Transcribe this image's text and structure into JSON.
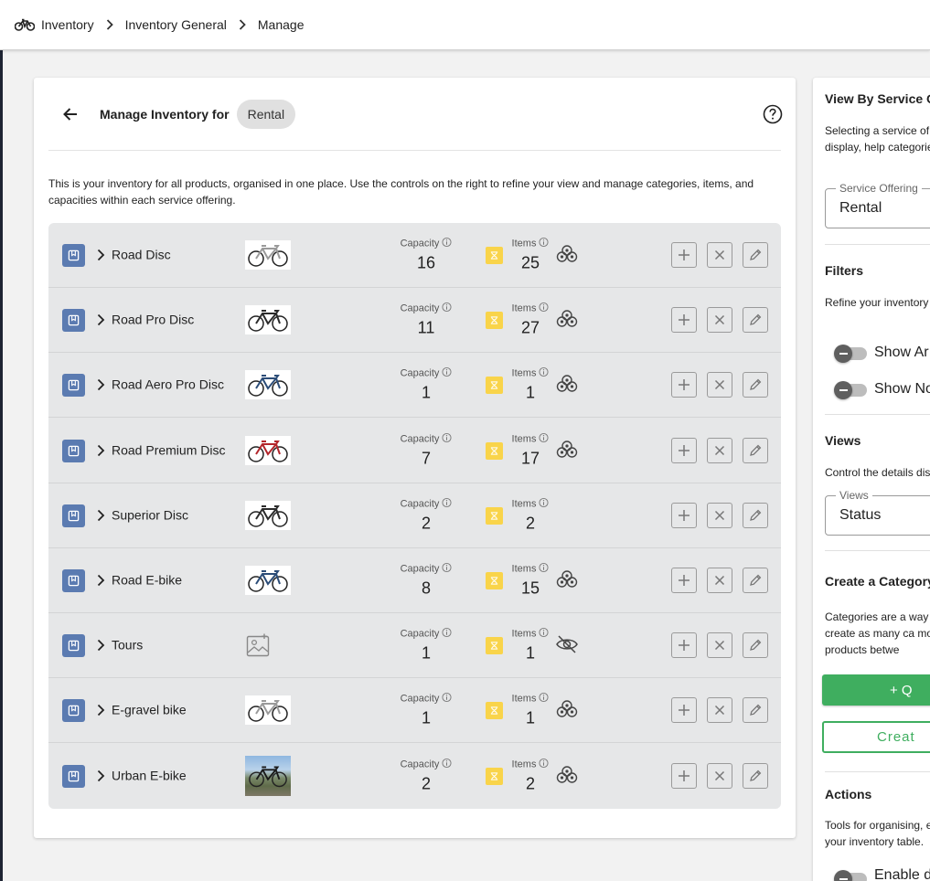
{
  "breadcrumb": {
    "items": [
      "Inventory",
      "Inventory General",
      "Manage"
    ]
  },
  "header": {
    "title": "Manage Inventory for",
    "service_chip": "Rental"
  },
  "description": "This is your inventory for all products, organised in one place. Use the controls on the right to refine your view and manage categories, items, and capacities within each service offering.",
  "columns": {
    "capacity_label": "Capacity",
    "items_label": "Items"
  },
  "rows": [
    {
      "name": "Road Disc",
      "capacity": "16",
      "items": "25",
      "image": "bike-white",
      "visibility": "group"
    },
    {
      "name": "Road Pro Disc",
      "capacity": "11",
      "items": "27",
      "image": "bike-dark",
      "visibility": "group"
    },
    {
      "name": "Road Aero Pro Disc",
      "capacity": "1",
      "items": "1",
      "image": "bike-blue",
      "visibility": "group"
    },
    {
      "name": "Road Premium Disc",
      "capacity": "7",
      "items": "17",
      "image": "bike-red",
      "visibility": "group"
    },
    {
      "name": "Superior Disc",
      "capacity": "2",
      "items": "2",
      "image": "bike-dark",
      "visibility": "none"
    },
    {
      "name": "Road E-bike",
      "capacity": "8",
      "items": "15",
      "image": "bike-blue",
      "visibility": "group"
    },
    {
      "name": "Tours",
      "capacity": "1",
      "items": "1",
      "image": "image-placeholder",
      "visibility": "hidden"
    },
    {
      "name": "E-gravel bike",
      "capacity": "1",
      "items": "1",
      "image": "bike-white",
      "visibility": "group"
    },
    {
      "name": "Urban E-bike",
      "capacity": "2",
      "items": "2",
      "image": "photo",
      "visibility": "group"
    }
  ],
  "sidebar": {
    "view_by_title": "View By Service Of",
    "view_by_text": "Selecting a service of inventory display, help categories and items",
    "service_offering_label": "Service Offering",
    "service_offering_value": "Rental",
    "filters_title": "Filters",
    "filters_text": "Refine your inventory items.",
    "toggle_1_label": "Show Ar",
    "toggle_2_label": "Show No",
    "views_title": "Views",
    "views_text": "Control the details dis",
    "views_label": "Views",
    "views_value": "Status",
    "create_title": "Create a Category",
    "create_text": "Categories are a way can create as many ca move products betwe",
    "quick_button": "+  Q",
    "create_button": "Creat",
    "actions_title": "Actions",
    "actions_text": "Tools for organising, e your inventory table.",
    "toggle_3_label": "Enable d"
  },
  "colors": {
    "category_icon": "#5b7bb1",
    "status_yellow": "#f9d44a",
    "primary_green": "#3fae5f",
    "table_bg": "#e6e7e8"
  }
}
